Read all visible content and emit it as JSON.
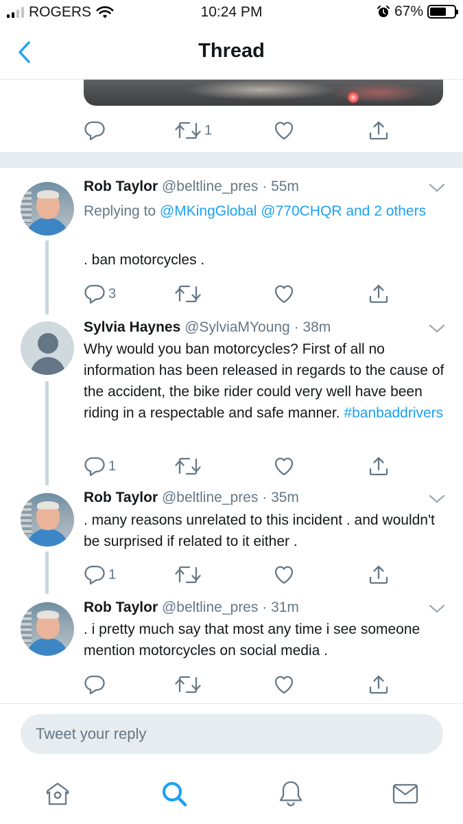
{
  "status_bar": {
    "carrier": "ROGERS",
    "time": "10:24 PM",
    "battery": "67%",
    "battery_level": 0.67
  },
  "nav": {
    "title": "Thread"
  },
  "parent_tweet": {
    "retweet_count": "1"
  },
  "tweets": [
    {
      "name": "Rob Taylor",
      "handle": "@beltline_pres",
      "sep": "·",
      "time": "55m",
      "reply_prefix": "Replying to ",
      "reply_mentions": "@MKingGlobal @770CHQR",
      "reply_and": " and 2 others",
      "text": ". ban motorcycles .",
      "reply_count": "3"
    },
    {
      "name": "Sylvia Haynes",
      "handle": "@SylviaMYoung",
      "sep": "·",
      "time": "38m",
      "text": "Why would you ban motorcycles?  First of all no information has been released in regards to the cause of the accident, the bike rider could very well have been riding in a respectable and safe manner.  ",
      "hashtag": "#banbaddrivers",
      "reply_count": "1"
    },
    {
      "name": "Rob Taylor",
      "handle": "@beltline_pres",
      "sep": "·",
      "time": "35m",
      "text": ". many reasons unrelated to this incident . and wouldn't be surprised if related to it either .",
      "reply_count": "1"
    },
    {
      "name": "Rob Taylor",
      "handle": "@beltline_pres",
      "sep": "·",
      "time": "31m",
      "text": ". i pretty much say that most any time i see someone mention motorcycles on social media .",
      "reply_count": ""
    }
  ],
  "compose": {
    "placeholder": "Tweet your reply"
  },
  "tabs": [
    "home-icon",
    "search-icon",
    "notifications-icon",
    "messages-icon"
  ],
  "colors": {
    "accent": "#1da1f2",
    "muted": "#657786",
    "text": "#14171a",
    "separator": "#e6ecf0"
  }
}
